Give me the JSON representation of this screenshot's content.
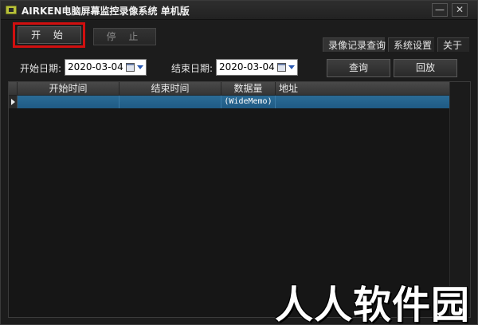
{
  "window": {
    "title": "AIRKEN电脑屏幕监控录像系统 单机版",
    "minimize_symbol": "—",
    "close_symbol": "✕"
  },
  "toolbar": {
    "start_label": "开 始",
    "stop_label": "停 止"
  },
  "tabs": [
    {
      "label": "录像记录查询",
      "active": true
    },
    {
      "label": "系统设置",
      "active": false
    },
    {
      "label": "关于",
      "active": false
    }
  ],
  "filters": {
    "start_date_label": "开始日期:",
    "start_date_value": "2020-03-04",
    "end_date_label": "结束日期:",
    "end_date_value": "2020-03-04",
    "query_label": "查询",
    "playback_label": "回放"
  },
  "grid": {
    "columns": [
      "开始时间",
      "结束时间",
      "数据量",
      "地址"
    ],
    "rows": [
      [
        "",
        "",
        "(WideMemo)",
        ""
      ]
    ]
  },
  "watermark": "人人软件园",
  "colors": {
    "highlight": "#d10f0f",
    "selected_row": "#1f5a84"
  }
}
